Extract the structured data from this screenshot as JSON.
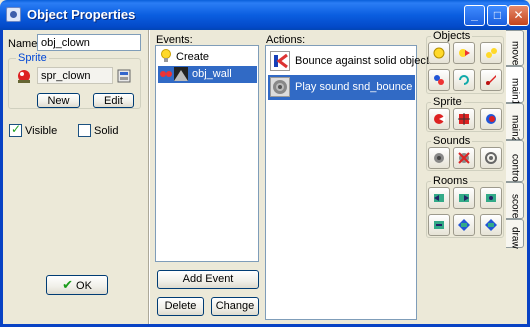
{
  "window": {
    "title": "Object Properties"
  },
  "name_label": "Name:",
  "name_value": "obj_clown",
  "sprite": {
    "group_title": "Sprite",
    "value": "spr_clown",
    "new_label": "New",
    "edit_label": "Edit"
  },
  "visible_label": "Visible",
  "solid_label": "Solid",
  "ok_label": "OK",
  "events": {
    "header": "Events:",
    "items": [
      {
        "label": "Create"
      },
      {
        "label": "obj_wall"
      }
    ],
    "add_event_label": "Add Event",
    "delete_label": "Delete",
    "change_label": "Change"
  },
  "actions": {
    "header": "Actions:",
    "items": [
      {
        "label": "Bounce against solid objects"
      },
      {
        "label": "Play sound snd_bounce"
      }
    ]
  },
  "palette": {
    "objects_title": "Objects",
    "sprite_title": "Sprite",
    "sounds_title": "Sounds",
    "rooms_title": "Rooms"
  },
  "tabs": [
    "move",
    "main1",
    "main2",
    "control",
    "score",
    "draw"
  ],
  "colors": {
    "accent": "#316ac5",
    "title_bar": "#0b5ee0"
  }
}
